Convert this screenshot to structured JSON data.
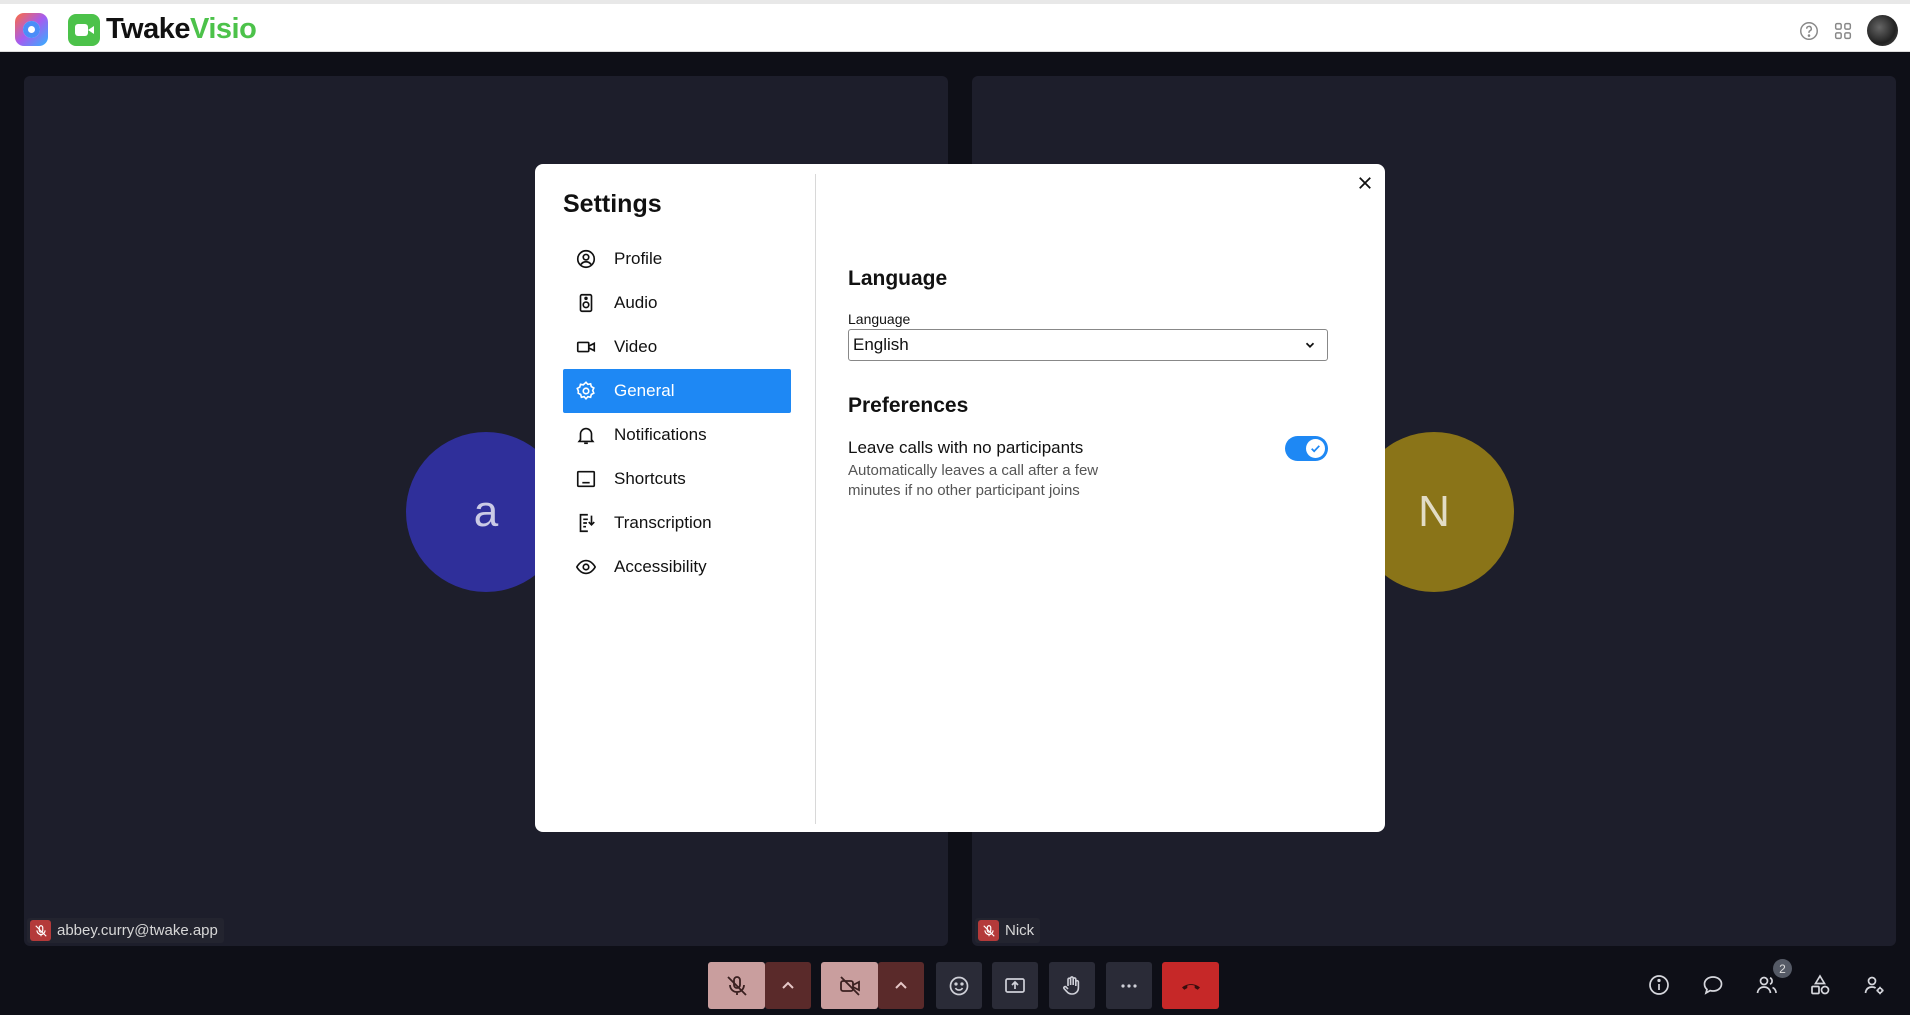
{
  "topbar": {
    "app_title_part1": "Twake",
    "app_title_part2": "Visio",
    "icons": [
      "apps-suite-logo",
      "visio-logo",
      "help-icon",
      "grid-apps-icon",
      "user-avatar"
    ]
  },
  "tiles": {
    "left": {
      "initial": "a",
      "name": "abbey.curry@twake.app",
      "color": "#2f2f9a"
    },
    "right": {
      "initial": "N",
      "name": "Nick",
      "color": "#8a7418"
    }
  },
  "settings": {
    "title": "Settings",
    "nav": [
      {
        "label": "Profile",
        "icon": "profile-icon"
      },
      {
        "label": "Audio",
        "icon": "speaker-icon"
      },
      {
        "label": "Video",
        "icon": "camera-icon"
      },
      {
        "label": "General",
        "icon": "gear-icon",
        "active": true
      },
      {
        "label": "Notifications",
        "icon": "bell-icon"
      },
      {
        "label": "Shortcuts",
        "icon": "keyboard-icon"
      },
      {
        "label": "Transcription",
        "icon": "document-icon"
      },
      {
        "label": "Accessibility",
        "icon": "eye-icon"
      }
    ],
    "language_section": "Language",
    "language_label": "Language",
    "language_value": "English",
    "preferences_section": "Preferences",
    "pref_leave_label": "Leave calls with no participants",
    "pref_leave_desc": "Automatically leaves a call after a few minutes if no other participant joins",
    "pref_leave_enabled": true
  },
  "controls": {
    "participants_count": "2",
    "accent": "#1e88f4",
    "hangup_color": "#c62828"
  }
}
